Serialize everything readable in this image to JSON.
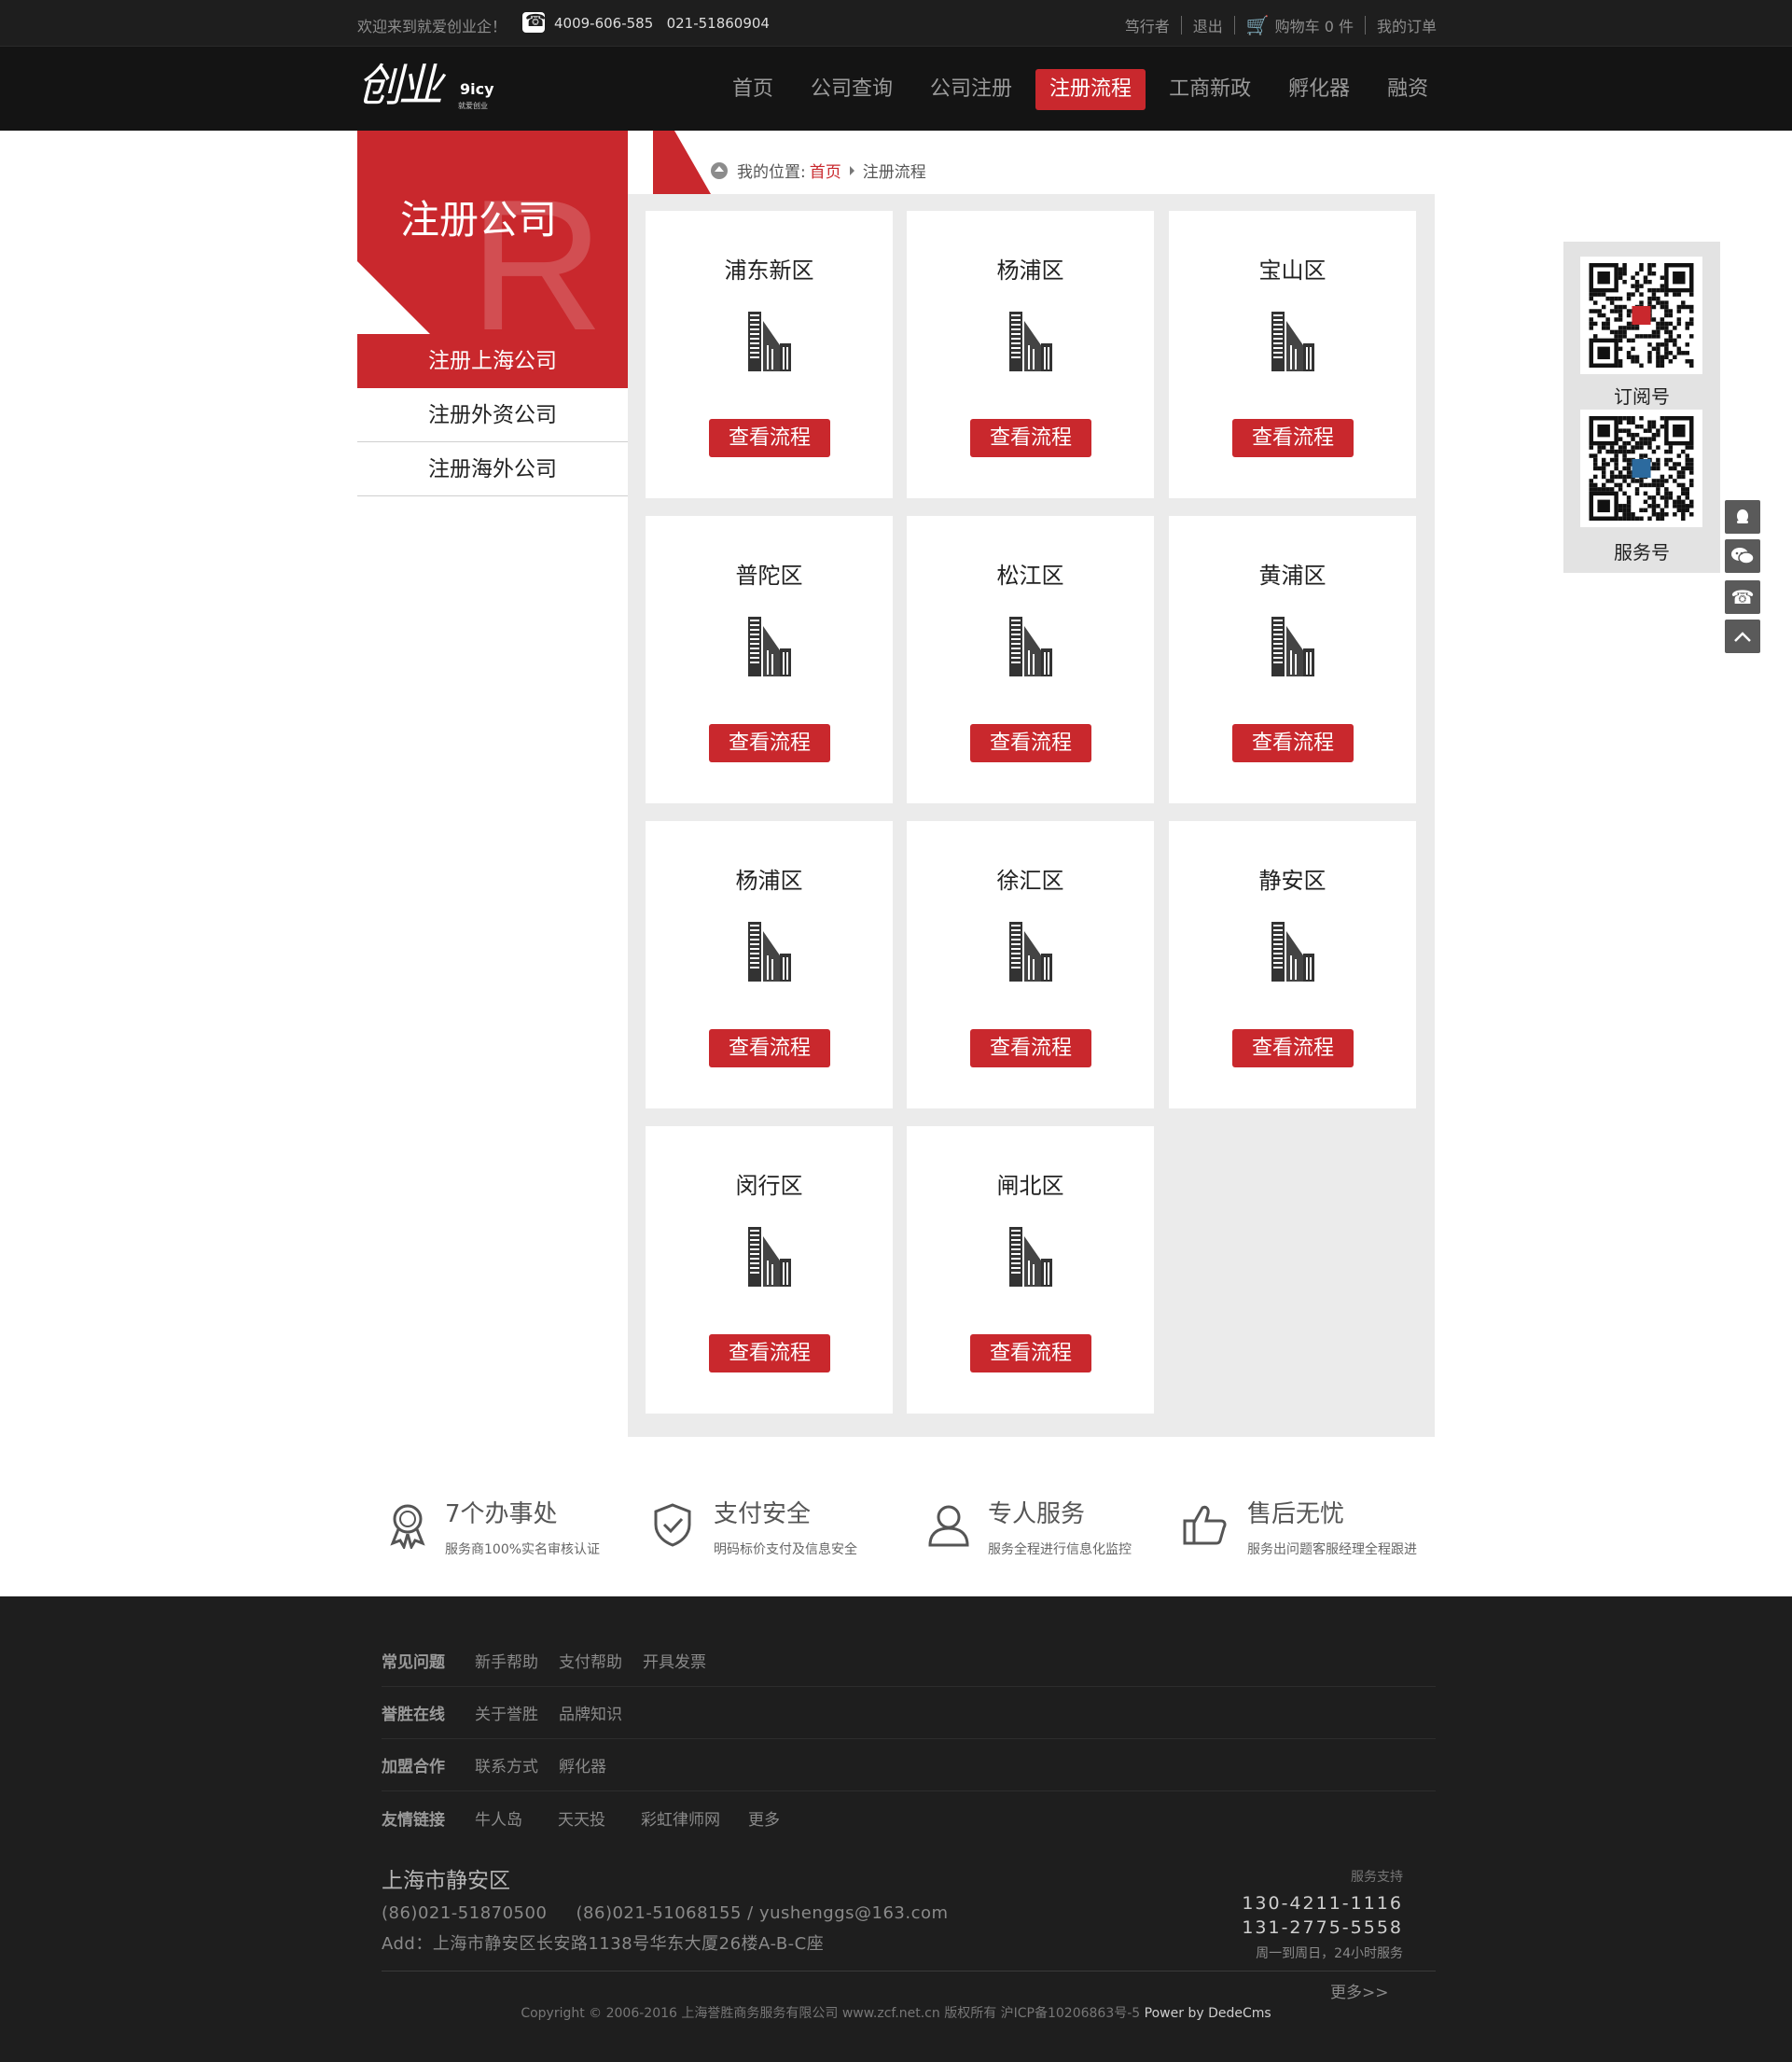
{
  "topbar": {
    "welcome": "欢迎来到就爱创业企！",
    "phones": "4009-606-585   021-51860904",
    "links": [
      "笃行者",
      "退出"
    ],
    "cart": "购物车 0 件",
    "orders": "我的订单"
  },
  "header": {
    "logo_mark": "创业",
    "logo_en": "9icy",
    "logo_cn": "就爱创业",
    "nav": [
      "首页",
      "公司查询",
      "公司注册",
      "注册流程",
      "工商新政",
      "孵化器",
      "融资"
    ],
    "nav_active": "注册流程"
  },
  "sidebar": {
    "banner_title": "注册公司",
    "banner_letter": "R",
    "items": [
      "注册上海公司",
      "注册外资公司",
      "注册海外公司"
    ]
  },
  "breadcrumb": {
    "label": "我的位置:",
    "home": "首页",
    "current": "注册流程"
  },
  "cards": {
    "button_label": "查看流程",
    "districts": [
      "浦东新区",
      "杨浦区",
      "宝山区",
      "普陀区",
      "松江区",
      "黄浦区",
      "杨浦区",
      "徐汇区",
      "静安区",
      "闵行区",
      "闸北区"
    ]
  },
  "float_panel": {
    "qr1_label": "订阅号",
    "qr2_label": "服务号",
    "buttons": [
      "qq-icon",
      "wechat-icon",
      "phone-icon",
      "back-to-top-icon"
    ]
  },
  "features": [
    {
      "title": "7个办事处",
      "sub": "服务商100%实名审核认证",
      "icon": "award-icon"
    },
    {
      "title": "支付安全",
      "sub": "明码标价支付及信息安全",
      "icon": "shield-check-icon"
    },
    {
      "title": "专人服务",
      "sub": "服务全程进行信息化监控",
      "icon": "person-icon"
    },
    {
      "title": "售后无忧",
      "sub": "服务出问题客服经理全程跟进",
      "icon": "thumbs-up-icon"
    }
  ],
  "footer": {
    "rows": [
      {
        "key": "常见问题",
        "links": [
          "新手帮助",
          "支付帮助",
          "开具发票"
        ]
      },
      {
        "key": "誉胜在线",
        "links": [
          "关于誉胜",
          "品牌知识"
        ]
      },
      {
        "key": "加盟合作",
        "links": [
          "联系方式",
          "孵化器"
        ]
      },
      {
        "key": "友情链接",
        "links": [
          "牛人岛",
          "天天投",
          "彩虹律师网",
          "更多"
        ]
      }
    ],
    "city": "上海市静安区",
    "contact_line": "(86)021-51870500     (86)021-51068155 / yushenggs@163.com",
    "address_line": "Add：上海市静安区长安路1138号华东大厦26楼A-B-C座",
    "support_label": "服务支持",
    "support_phone1": "130-4211-1116",
    "support_phone2": "131-2775-5558",
    "support_hours": "周一到周日，24小时服务",
    "more": "更多>>",
    "copyright": "Copyright © 2006-2016 上海誉胜商务服务有限公司 www.zcf.net.cn  版权所有  沪ICP备10206863号-5 ",
    "powered": "Power by DedeCms"
  },
  "colors": {
    "accent": "#c9282d",
    "dark_bg": "#1e1e1e",
    "grid_bg": "#ebebeb"
  }
}
